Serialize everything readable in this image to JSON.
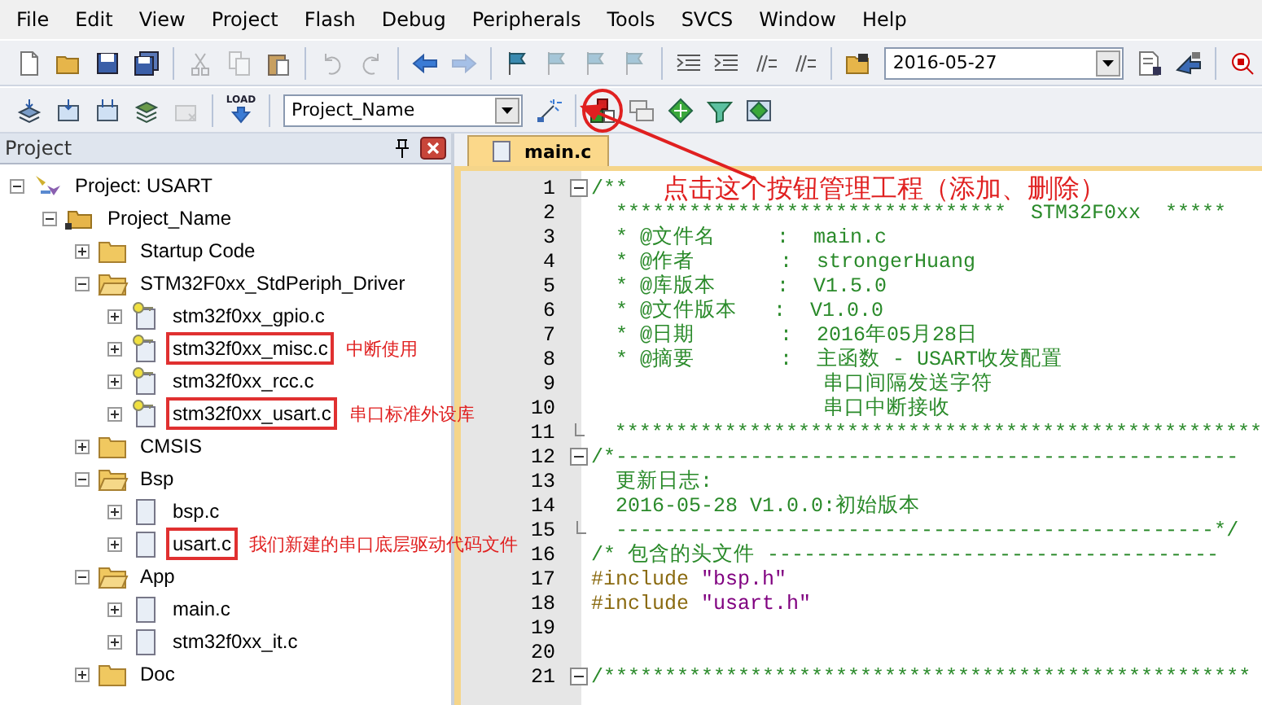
{
  "menu": [
    "File",
    "Edit",
    "View",
    "Project",
    "Flash",
    "Debug",
    "Peripherals",
    "Tools",
    "SVCS",
    "Window",
    "Help"
  ],
  "toolbar_1": [
    {
      "kind": "new",
      "disabled": false
    },
    {
      "kind": "open",
      "disabled": false
    },
    {
      "kind": "save",
      "disabled": false
    },
    {
      "kind": "saveall",
      "disabled": false
    },
    {
      "kind": "sep"
    },
    {
      "kind": "cut",
      "disabled": true
    },
    {
      "kind": "copy",
      "disabled": true
    },
    {
      "kind": "paste",
      "disabled": false
    },
    {
      "kind": "sep"
    },
    {
      "kind": "undo",
      "disabled": true
    },
    {
      "kind": "redo",
      "disabled": true
    },
    {
      "kind": "sep"
    },
    {
      "kind": "back",
      "disabled": false
    },
    {
      "kind": "forward",
      "disabled": true
    },
    {
      "kind": "sep"
    },
    {
      "kind": "bookmark",
      "disabled": false
    },
    {
      "kind": "bookmark",
      "disabled": true
    },
    {
      "kind": "bookmark",
      "disabled": true
    },
    {
      "kind": "bookmark",
      "disabled": true
    },
    {
      "kind": "sep"
    },
    {
      "kind": "indent",
      "disabled": false
    },
    {
      "kind": "indent",
      "disabled": false
    },
    {
      "kind": "comment",
      "disabled": false
    },
    {
      "kind": "comment",
      "disabled": false
    },
    {
      "kind": "sep"
    },
    {
      "kind": "findfiles",
      "disabled": false
    },
    {
      "kind": "combo",
      "value": "2016-05-27"
    },
    {
      "kind": "doc",
      "disabled": false
    },
    {
      "kind": "tools",
      "disabled": false
    },
    {
      "kind": "sep"
    },
    {
      "kind": "debug",
      "disabled": false
    }
  ],
  "toolbar_2": [
    {
      "kind": "translate",
      "disabled": false
    },
    {
      "kind": "build",
      "disabled": false
    },
    {
      "kind": "rebuild",
      "disabled": false
    },
    {
      "kind": "batch",
      "disabled": false
    },
    {
      "kind": "stop",
      "disabled": true
    },
    {
      "kind": "sep"
    },
    {
      "kind": "load",
      "label": "LOAD",
      "disabled": false
    },
    {
      "kind": "sep"
    },
    {
      "kind": "combo",
      "value": "Project_Name"
    },
    {
      "kind": "wand",
      "disabled": false
    },
    {
      "kind": "sep"
    },
    {
      "kind": "manage",
      "disabled": false,
      "circled": true
    },
    {
      "kind": "windows",
      "disabled": false
    },
    {
      "kind": "diamond",
      "disabled": false
    },
    {
      "kind": "funnel",
      "disabled": false
    },
    {
      "kind": "stack",
      "disabled": false
    }
  ],
  "project_panel": {
    "title": "Project",
    "tree": [
      {
        "label": "Project: USART",
        "kind": "project",
        "expanded": true,
        "children": [
          {
            "label": "Project_Name",
            "kind": "target",
            "expanded": true,
            "children": [
              {
                "label": "Startup Code",
                "kind": "folder",
                "expanded": false
              },
              {
                "label": "STM32F0xx_StdPeriph_Driver",
                "kind": "folder",
                "expanded": true,
                "children": [
                  {
                    "label": "stm32f0xx_gpio.c",
                    "kind": "keyfile",
                    "boxed": false
                  },
                  {
                    "label": "stm32f0xx_misc.c",
                    "kind": "keyfile",
                    "boxed": true,
                    "note": "中断使用"
                  },
                  {
                    "label": "stm32f0xx_rcc.c",
                    "kind": "keyfile",
                    "boxed": false
                  },
                  {
                    "label": "stm32f0xx_usart.c",
                    "kind": "keyfile",
                    "boxed": true,
                    "note": "串口标准外设库"
                  }
                ]
              },
              {
                "label": "CMSIS",
                "kind": "folder",
                "expanded": false
              },
              {
                "label": "Bsp",
                "kind": "folder",
                "expanded": true,
                "children": [
                  {
                    "label": "bsp.c",
                    "kind": "file",
                    "boxed": false
                  },
                  {
                    "label": "usart.c",
                    "kind": "file",
                    "boxed": true,
                    "note": "我们新建的串口底层驱动代码文件"
                  }
                ]
              },
              {
                "label": "App",
                "kind": "folder",
                "expanded": true,
                "children": [
                  {
                    "label": "main.c",
                    "kind": "file",
                    "boxed": false
                  },
                  {
                    "label": "stm32f0xx_it.c",
                    "kind": "file",
                    "boxed": false
                  }
                ]
              },
              {
                "label": "Doc",
                "kind": "folder",
                "expanded": false
              }
            ]
          }
        ]
      }
    ]
  },
  "editor": {
    "tabs": [
      {
        "label": "main.c",
        "selected": true
      }
    ],
    "callout": "点击这个按钮管理工程（添加、删除）",
    "lines": [
      {
        "num": "1",
        "collapsible": true,
        "kind": "comment",
        "text": "/**"
      },
      {
        "num": "2",
        "kind": "comment",
        "text": "  ********************************  STM32F0xx  *****"
      },
      {
        "num": "3",
        "kind": "comment",
        "text": "  * @文件名     :  main.c"
      },
      {
        "num": "4",
        "kind": "comment",
        "text": "  * @作者       :  strongerHuang"
      },
      {
        "num": "5",
        "kind": "comment",
        "text": "  * @库版本     :  V1.5.0"
      },
      {
        "num": "6",
        "kind": "comment",
        "text": "  * @文件版本   :  V1.0.0"
      },
      {
        "num": "7",
        "kind": "comment",
        "text": "  * @日期       :  2016年05月28日"
      },
      {
        "num": "8",
        "kind": "comment",
        "text": "  * @摘要       :  主函数 - USART收发配置"
      },
      {
        "num": "9",
        "kind": "comment",
        "text": "                   串口间隔发送字符"
      },
      {
        "num": "10",
        "kind": "comment",
        "text": "                   串口中断接收"
      },
      {
        "num": "11",
        "block_end": true,
        "kind": "comment",
        "text": "  *****************************************************"
      },
      {
        "num": "12",
        "collapsible": true,
        "kind": "comment",
        "text": "/*---------------------------------------------------"
      },
      {
        "num": "13",
        "kind": "comment",
        "text": "  更新日志:"
      },
      {
        "num": "14",
        "kind": "comment",
        "text": "  2016-05-28 V1.0.0:初始版本"
      },
      {
        "num": "15",
        "block_end": true,
        "kind": "comment",
        "text": "  -------------------------------------------------*/"
      },
      {
        "num": "16",
        "kind": "comment",
        "text": "/* 包含的头文件 -------------------------------------"
      },
      {
        "num": "17",
        "kind": "include",
        "directive": "#include",
        "path": "\"bsp.h\""
      },
      {
        "num": "18",
        "kind": "include",
        "directive": "#include",
        "path": "\"usart.h\""
      },
      {
        "num": "19",
        "kind": "blank"
      },
      {
        "num": "20",
        "kind": "blank"
      },
      {
        "num": "21",
        "collapsible": true,
        "kind": "comment",
        "text": "/*****************************************************"
      }
    ]
  }
}
